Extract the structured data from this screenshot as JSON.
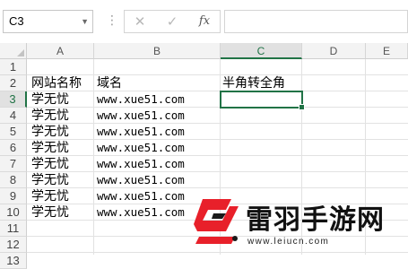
{
  "name_box": {
    "value": "C3",
    "dropdown_icon": "chevron-down-icon"
  },
  "formula_bar": {
    "cancel_icon": "close-icon",
    "enter_icon": "check-icon",
    "fx_label": "fx",
    "value": ""
  },
  "columns": [
    "A",
    "B",
    "C",
    "D",
    "E"
  ],
  "rows": [
    "1",
    "2",
    "3",
    "4",
    "5",
    "6",
    "7",
    "8",
    "9",
    "10",
    "11",
    "12",
    "13"
  ],
  "active_cell": "C3",
  "cells": {
    "A2": "网站名称",
    "B2": "域名",
    "C2": "半角转全角",
    "A3": "学无忧",
    "B3": "www.xue51.com",
    "A4": "学无忧",
    "B4": "www.xue51.com",
    "A5": "学无忧",
    "B5": "www.xue51.com",
    "A6": "学无忧",
    "B6": "www.xue51.com",
    "A7": "学无忧",
    "B7": "www.xue51.com",
    "A8": "学无忧",
    "B8": "www.xue51.com",
    "A9": "学无忧",
    "B9": "www.xue51.com",
    "A10": "学无忧",
    "B10": "www.xue51.com"
  },
  "watermark": {
    "title": "雷羽手游网",
    "url": "www.leiucn.com",
    "logo_color": "#e8202a",
    "logo_accent": "#1a1a1a"
  },
  "colors": {
    "accent": "#217346"
  }
}
